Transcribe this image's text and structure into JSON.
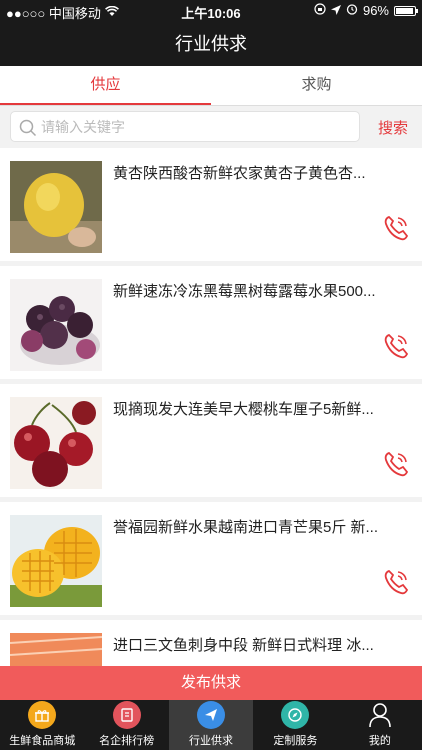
{
  "status_bar": {
    "carrier": "●●○○○ 中国移动",
    "time": "上午10:06",
    "battery": "96%"
  },
  "nav": {
    "title": "行业供求"
  },
  "tabs": [
    {
      "label": "供应",
      "active": true
    },
    {
      "label": "求购",
      "active": false
    }
  ],
  "search": {
    "placeholder": "请输入关键字",
    "button_label": "搜索"
  },
  "items": [
    {
      "title": "黄杏陕西酸杏新鲜农家黄杏子黄色杏...",
      "image": "apricot"
    },
    {
      "title": "新鲜速冻冷冻黑莓黑树莓露莓水果500...",
      "image": "blackberry"
    },
    {
      "title": "现摘现发大连美早大樱桃车厘子5新鲜...",
      "image": "cherry"
    },
    {
      "title": "誉福园新鲜水果越南进口青芒果5斤 新...",
      "image": "mango"
    },
    {
      "title": "进口三文鱼刺身中段 新鲜日式料理 冰...",
      "image": "salmon"
    }
  ],
  "publish_label": "发布供求",
  "colors": {
    "accent": "#e4393c",
    "publish": "#f15b5b",
    "dark": "#1a1a1a"
  },
  "bottom_tabs": [
    {
      "label": "生鲜食品商城",
      "icon": "gift-icon"
    },
    {
      "label": "名企排行榜",
      "icon": "rank-icon"
    },
    {
      "label": "行业供求",
      "icon": "send-icon",
      "active": true
    },
    {
      "label": "定制服务",
      "icon": "compass-icon"
    },
    {
      "label": "我的",
      "icon": "user-icon"
    }
  ]
}
